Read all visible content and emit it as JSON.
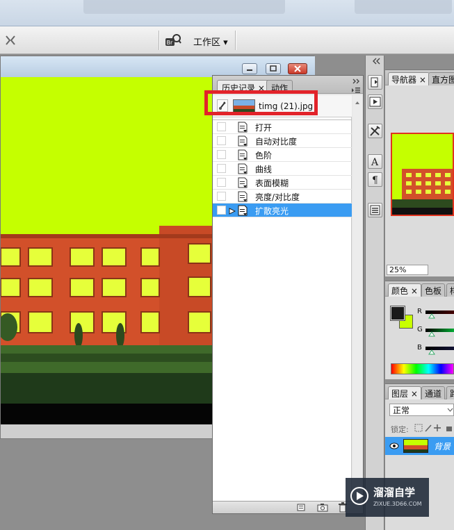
{
  "options_bar": {
    "bridge_icon": "bridge-br-icon",
    "workspace_label": "工作区",
    "workspace_arrow": "▾"
  },
  "history_panel": {
    "tabs": [
      {
        "label": "历史记录",
        "close": "×"
      },
      {
        "label": "动作"
      }
    ],
    "snapshot": {
      "label": "timg (21).jpg"
    },
    "items": [
      {
        "label": "打开"
      },
      {
        "label": "自动对比度"
      },
      {
        "label": "色阶"
      },
      {
        "label": "曲线"
      },
      {
        "label": "表面模糊"
      },
      {
        "label": "亮度/对比度"
      },
      {
        "label": "扩散亮光",
        "selected": true
      }
    ],
    "highlight_color": "#e2232a",
    "selected_color": "#3a9cf2"
  },
  "navigator_panel": {
    "tabs": [
      {
        "label": "导航器",
        "close": "×"
      },
      {
        "label": "直方图"
      }
    ],
    "zoom": "25%"
  },
  "color_panel": {
    "tabs": [
      {
        "label": "颜色",
        "close": "×"
      },
      {
        "label": "色板"
      },
      {
        "label": "样"
      }
    ],
    "channels": [
      "R",
      "G",
      "B"
    ],
    "foreground": "#1a1a1a",
    "background": "#c8ff00"
  },
  "layers_panel": {
    "tabs": [
      {
        "label": "图层",
        "close": "×"
      },
      {
        "label": "通道"
      },
      {
        "label": "路"
      }
    ],
    "blend_mode": "正常",
    "lock_label": "锁定:",
    "layer": {
      "name": "背景"
    }
  },
  "watermark": {
    "title": "溜溜自学",
    "url": "ZIXUE.3D66.COM"
  },
  "image_colors": {
    "sky": "#c5ff00",
    "brick": "#d2502a",
    "window": "#e6ff3a",
    "ground": "#1f3a1a"
  }
}
